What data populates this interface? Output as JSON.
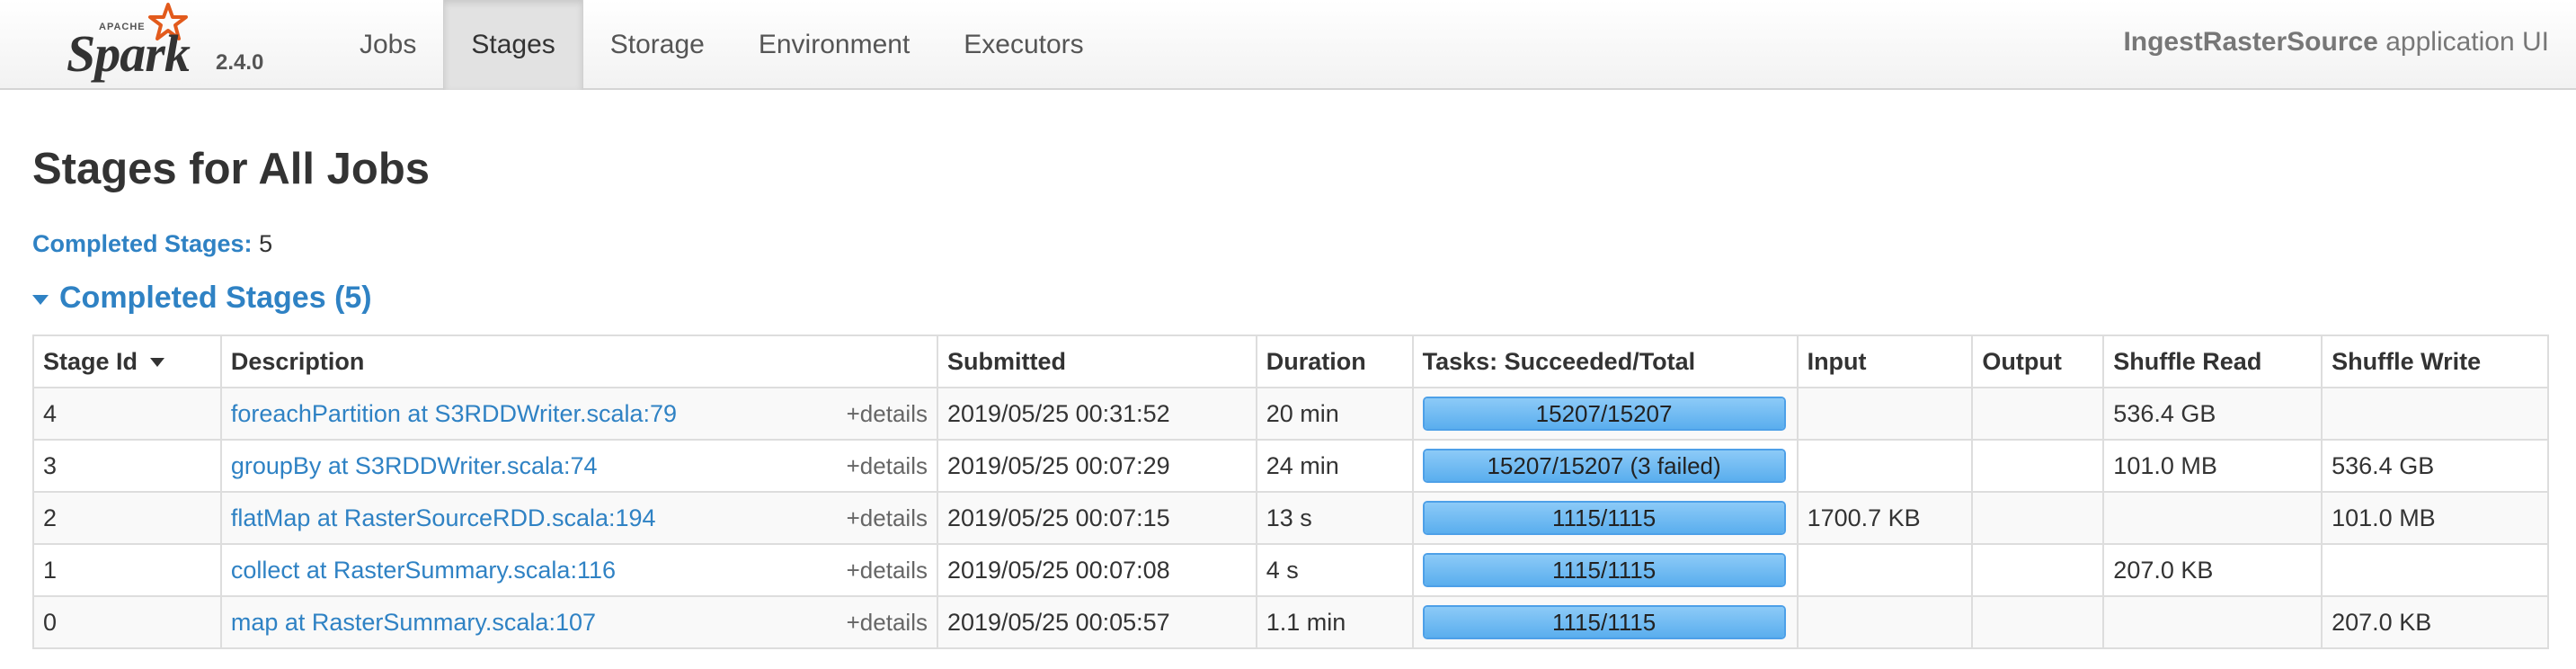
{
  "brand": {
    "apache": "APACHE",
    "name": "Spark",
    "version": "2.4.0"
  },
  "nav": [
    "Jobs",
    "Stages",
    "Storage",
    "Environment",
    "Executors"
  ],
  "nav_active": "Stages",
  "app": {
    "name": "IngestRasterSource",
    "suffix": "application UI"
  },
  "page_title": "Stages for All Jobs",
  "summary": {
    "label": "Completed Stages:",
    "value": "5"
  },
  "section": {
    "title": "Completed Stages (5)"
  },
  "table": {
    "headers": [
      "Stage Id",
      "Description",
      "Submitted",
      "Duration",
      "Tasks: Succeeded/Total",
      "Input",
      "Output",
      "Shuffle Read",
      "Shuffle Write"
    ],
    "details_label": "+details",
    "rows": [
      {
        "id": "4",
        "description": "foreachPartition at S3RDDWriter.scala:79",
        "submitted": "2019/05/25 00:31:52",
        "duration": "20 min",
        "tasks": "15207/15207",
        "progress": 1.0,
        "input": "",
        "output": "",
        "shuffle_read": "536.4 GB",
        "shuffle_write": ""
      },
      {
        "id": "3",
        "description": "groupBy at S3RDDWriter.scala:74",
        "submitted": "2019/05/25 00:07:29",
        "duration": "24 min",
        "tasks": "15207/15207 (3 failed)",
        "progress": 1.0,
        "input": "",
        "output": "",
        "shuffle_read": "101.0 MB",
        "shuffle_write": "536.4 GB"
      },
      {
        "id": "2",
        "description": "flatMap at RasterSourceRDD.scala:194",
        "submitted": "2019/05/25 00:07:15",
        "duration": "13 s",
        "tasks": "1115/1115",
        "progress": 1.0,
        "input": "1700.7 KB",
        "output": "",
        "shuffle_read": "",
        "shuffle_write": "101.0 MB"
      },
      {
        "id": "1",
        "description": "collect at RasterSummary.scala:116",
        "submitted": "2019/05/25 00:07:08",
        "duration": "4 s",
        "tasks": "1115/1115",
        "progress": 1.0,
        "input": "",
        "output": "",
        "shuffle_read": "207.0 KB",
        "shuffle_write": ""
      },
      {
        "id": "0",
        "description": "map at RasterSummary.scala:107",
        "submitted": "2019/05/25 00:05:57",
        "duration": "1.1 min",
        "tasks": "1115/1115",
        "progress": 1.0,
        "input": "",
        "output": "",
        "shuffle_read": "",
        "shuffle_write": "207.0 KB"
      }
    ]
  },
  "colors": {
    "link": "#2f82c4",
    "progress_fill": "#5aaeee",
    "progress_border": "#4da0e8",
    "star": "#e25a1c"
  }
}
